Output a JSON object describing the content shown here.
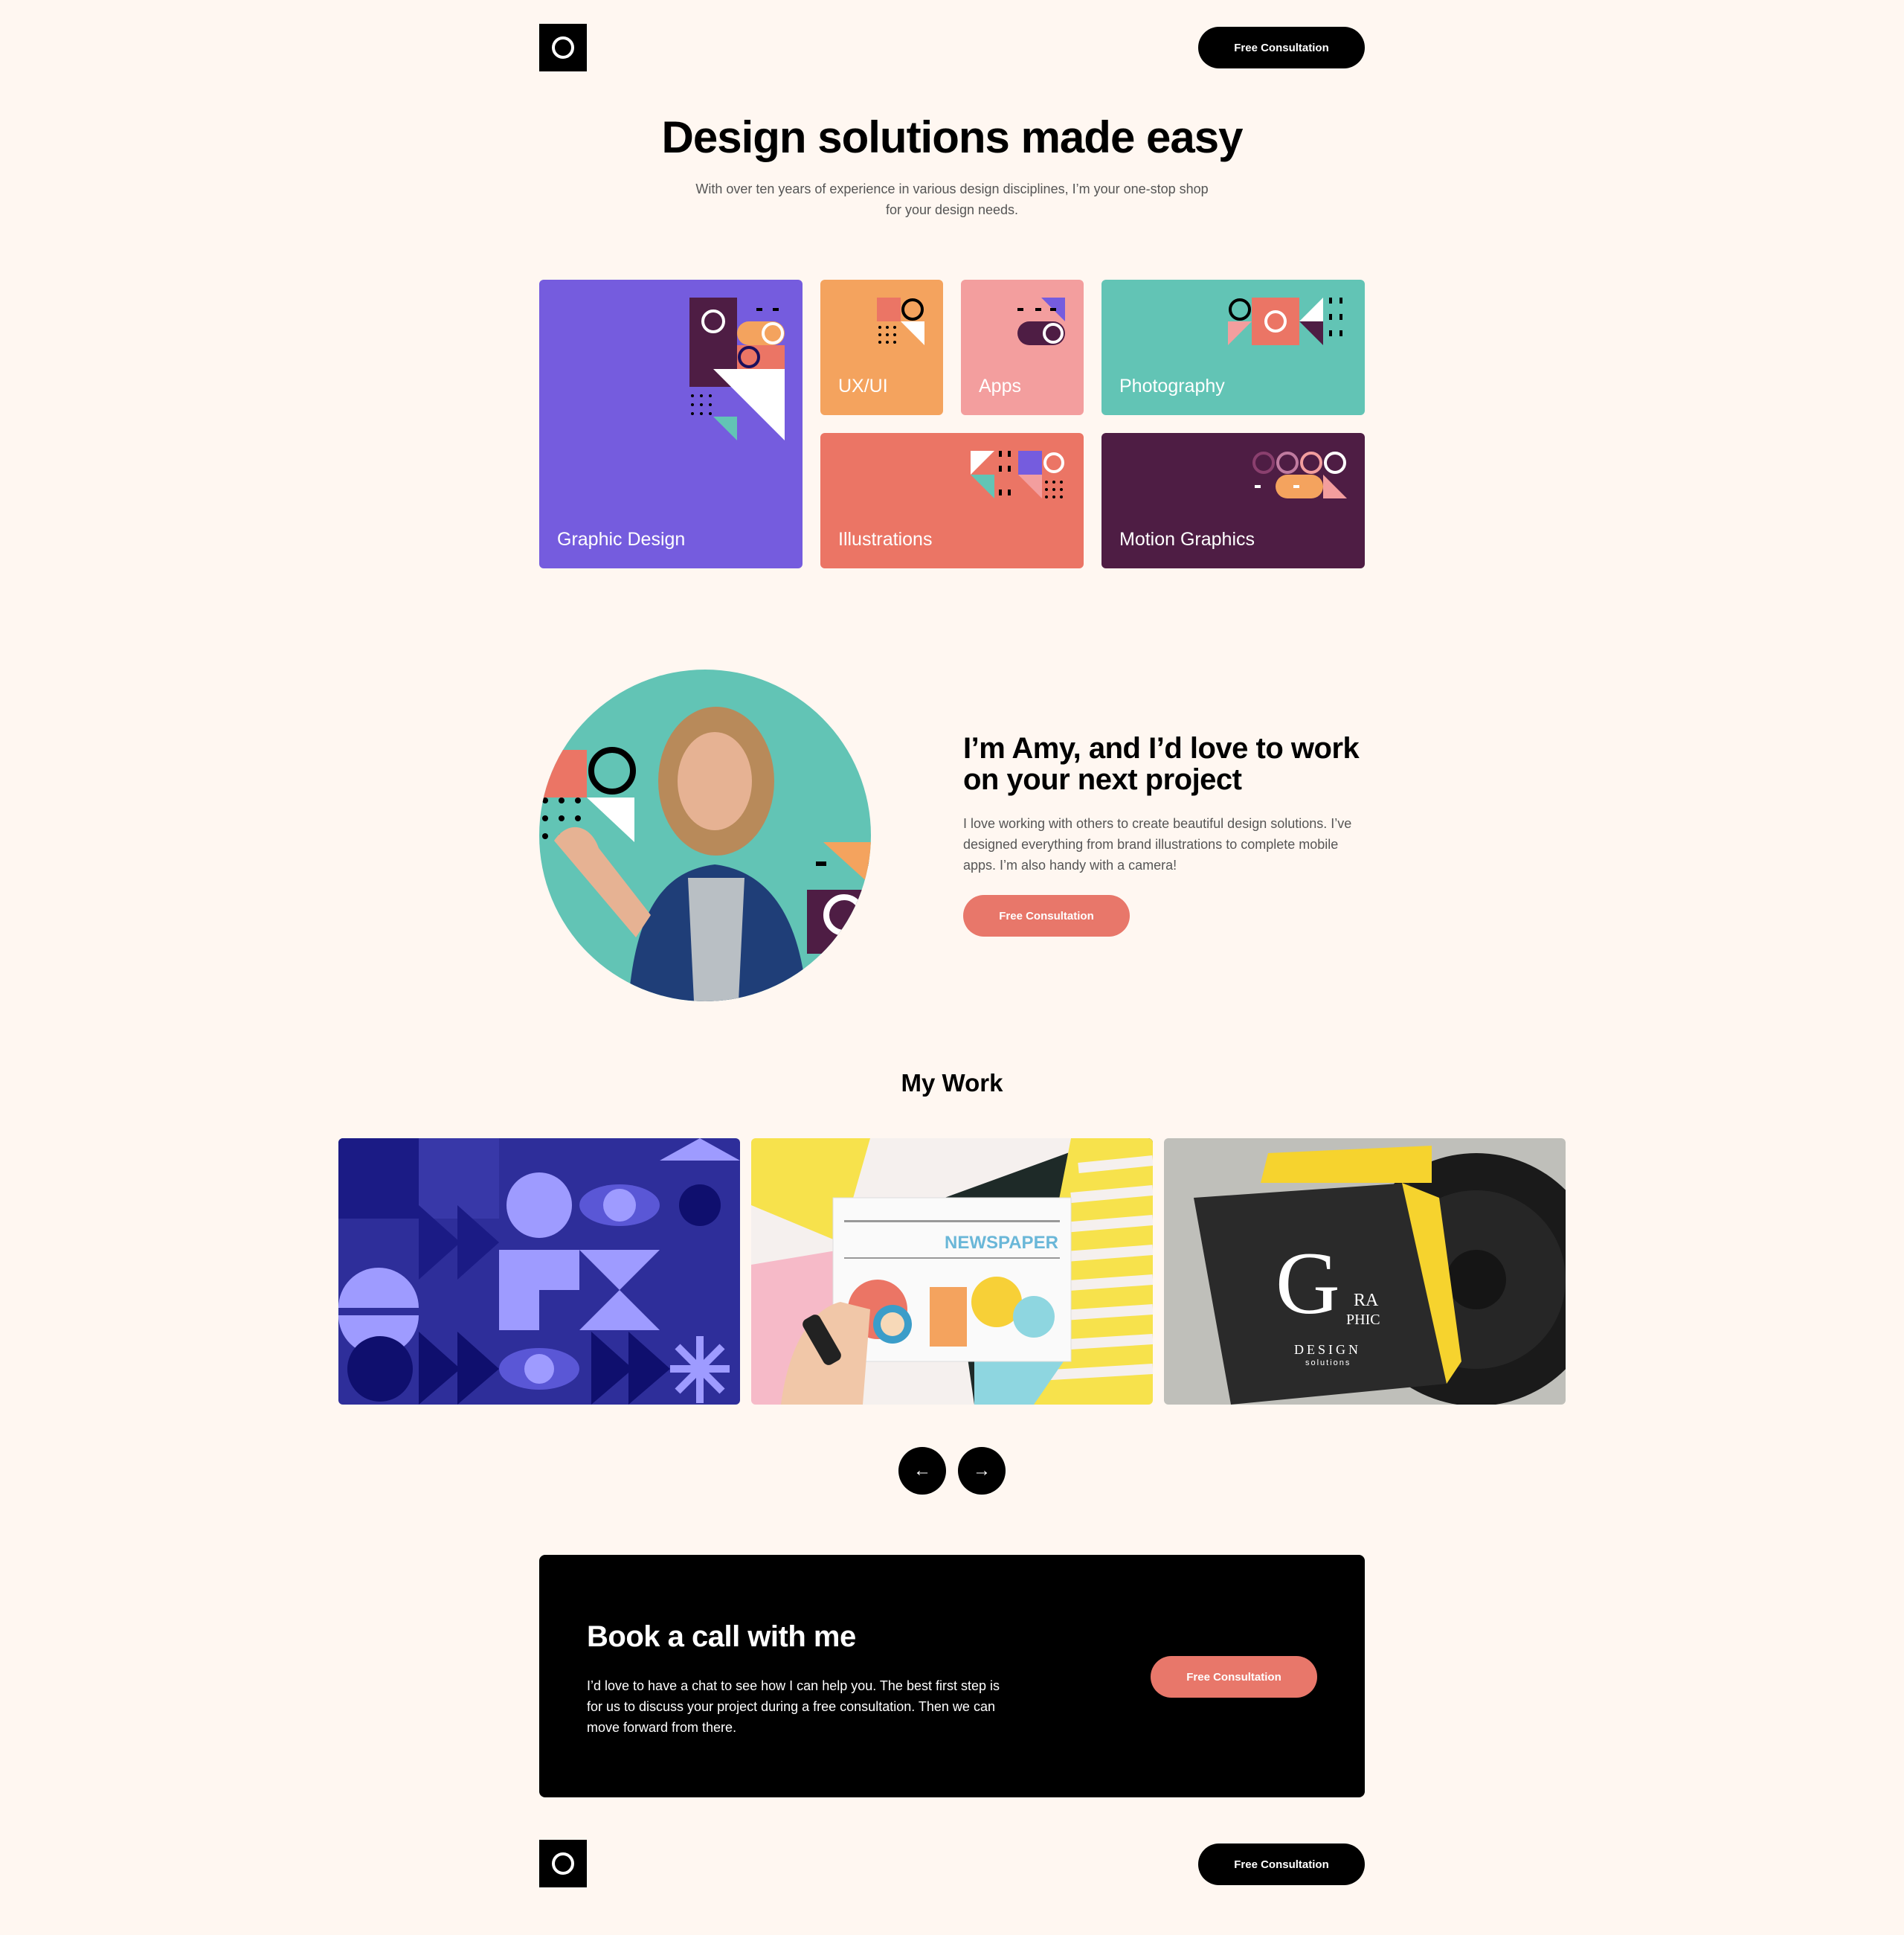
{
  "header": {
    "logo": "circle-logo",
    "cta_label": "Free Consultation"
  },
  "hero": {
    "title": "Design solutions made easy",
    "subtitle": "With over ten years of experience in various design disciplines, I’m your one-stop shop for your design needs."
  },
  "services": [
    {
      "label": "Graphic Design",
      "color": "#755CDE"
    },
    {
      "label": "UX/UI",
      "color": "#F4A35E"
    },
    {
      "label": "Apps",
      "color": "#F39E9E"
    },
    {
      "label": "Photography",
      "color": "#62C4B5"
    },
    {
      "label": "Illustrations",
      "color": "#EB7565"
    },
    {
      "label": "Motion Graphics",
      "color": "#4E1D44"
    }
  ],
  "about": {
    "title": "I’m Amy, and I’d love to work on your next project",
    "text": "I love working with others to create beautiful design solutions. I’ve designed everything from brand illustrations to complete mobile apps. I’m also handy with a camera!",
    "cta_label": "Free Consultation"
  },
  "work": {
    "title": "My Work",
    "items": [
      "geometric-pattern-image",
      "newspaper-image",
      "graphic-design-book-image"
    ],
    "newspaper_text": "NEWSPAPER",
    "book_text_g": "G",
    "book_text_ra": "RA",
    "book_text_phic": "PHIC",
    "book_text_design": "DESIGN",
    "book_text_solutions": "solutions",
    "prev_icon": "arrow-left-icon",
    "next_icon": "arrow-right-icon"
  },
  "cta": {
    "title": "Book a call with me",
    "text": "I’d love to have a chat to see how I can help you. The best first step is for us to discuss your project during a free consultation. Then we can move forward from there.",
    "button_label": "Free Consultation"
  },
  "footer": {
    "logo": "circle-logo",
    "cta_label": "Free Consultation"
  },
  "colors": {
    "background": "#FFF7F1",
    "coral": "#E8776A",
    "black": "#000000"
  }
}
